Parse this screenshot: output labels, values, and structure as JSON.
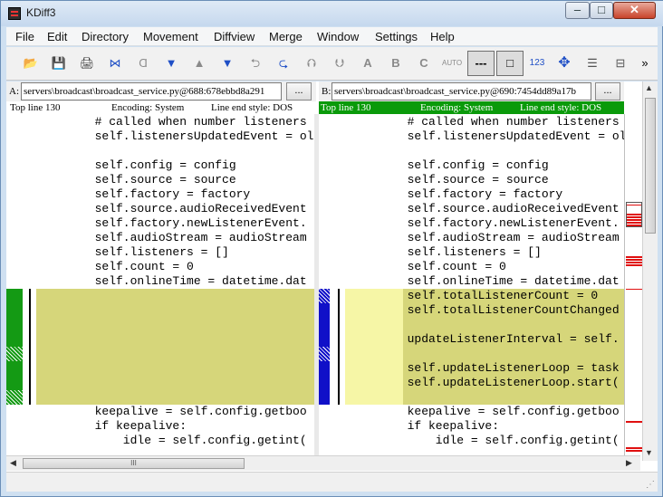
{
  "window": {
    "title": "KDiff3",
    "minimize": "–",
    "maximize": "□",
    "close": "✕"
  },
  "menu": [
    "File",
    "Edit",
    "Directory",
    "Movement",
    "Diffview",
    "Merge",
    "Window",
    "Settings",
    "Help"
  ],
  "toolbar": {
    "buttons": [
      {
        "icon": "open-icon",
        "glyph": "📂"
      },
      {
        "icon": "save-icon",
        "glyph": "💾"
      },
      {
        "icon": "print-icon",
        "glyph": "🖨"
      },
      {
        "icon": "goto-current-delta-icon",
        "glyph": "⋈"
      },
      {
        "icon": "goto-first-delta-icon",
        "glyph": "Ɑ"
      },
      {
        "icon": "goto-last-delta-icon",
        "glyph": "▼"
      },
      {
        "icon": "goto-prev-delta-icon",
        "glyph": "▲"
      },
      {
        "icon": "goto-next-delta-icon",
        "glyph": "▼"
      },
      {
        "icon": "goto-prev-conflict-icon",
        "glyph": "⮌"
      },
      {
        "icon": "goto-next-conflict-icon",
        "glyph": "⮎"
      },
      {
        "icon": "goto-prev-unsolved-icon",
        "glyph": "⮉"
      },
      {
        "icon": "goto-next-unsolved-icon",
        "glyph": "⮋"
      },
      {
        "icon": "select-a-icon",
        "glyph": "A"
      },
      {
        "icon": "select-b-icon",
        "glyph": "B"
      },
      {
        "icon": "select-c-icon",
        "glyph": "C"
      },
      {
        "icon": "auto-solve-icon",
        "glyph": "AUTO"
      },
      {
        "icon": "show-whitespace-icon",
        "glyph": "---"
      },
      {
        "icon": "show-white-space-chars-icon",
        "glyph": "□"
      },
      {
        "icon": "line-numbers-icon",
        "glyph": "123"
      },
      {
        "icon": "word-wrap-icon",
        "glyph": "✥"
      },
      {
        "icon": "overview-layout-icon",
        "glyph": "☰"
      },
      {
        "icon": "window-split-icon",
        "glyph": "⊟"
      },
      {
        "icon": "more-icon",
        "glyph": "»"
      }
    ]
  },
  "paneA": {
    "letter": "A:",
    "path": "servers\\broadcast\\broadcast_service.py@688:678ebbd8a291",
    "browse": "...",
    "topline": "Top line 130",
    "encoding": "Encoding: System",
    "lineend": "Line end style: DOS",
    "lines": [
      "  # called when number listeners",
      "  self.listenersUpdatedEvent = ol",
      "",
      "  self.config = config",
      "  self.source = source",
      "  self.factory = factory",
      "  self.source.audioReceivedEvent",
      "  self.factory.newListenerEvent.",
      "  self.audioStream = audioStream",
      "  self.listeners = []",
      "  self.count = 0",
      "  self.onlineTime = datetime.dat",
      "",
      "",
      "",
      "",
      "",
      "",
      "",
      "",
      "  keepalive = self.config.getboo",
      "  if keepalive:",
      "      idle = self.config.getint("
    ]
  },
  "paneB": {
    "letter": "B:",
    "path": "servers\\broadcast\\broadcast_service.py@690:7454dd89a17b",
    "browse": "...",
    "topline": "Top line 130",
    "encoding": "Encoding: System",
    "lineend": "Line end style: DOS",
    "lines": [
      "  # called when number listeners",
      "  self.listenersUpdatedEvent = ol",
      "",
      "  self.config = config",
      "  self.source = source",
      "  self.factory = factory",
      "  self.source.audioReceivedEvent",
      "  self.factory.newListenerEvent.",
      "  self.audioStream = audioStream",
      "  self.listeners = []",
      "  self.count = 0",
      "  self.onlineTime = datetime.dat",
      "  self.totalListenerCount = 0",
      "  self.totalListenerCountChanged",
      "",
      "  updateListenerInterval = self.",
      "",
      "  self.updateListenerLoop = task",
      "  self.updateListenerLoop.start(",
      "",
      "  keepalive = self.config.getboo",
      "  if keepalive:",
      "      idle = self.config.getint("
    ]
  },
  "scroll": {
    "up": "▲",
    "down": "▼",
    "left": "◀",
    "right": "▶",
    "thumb_grip": "III"
  },
  "colors": {
    "diff_a_bg": "#d6d67a",
    "diff_b_bg": "#f6f6a6",
    "pane_a_marker": "#149a14",
    "pane_b_marker": "#1010c8",
    "active_bar": "#0a9a0a",
    "overview_red": "#e01010"
  }
}
